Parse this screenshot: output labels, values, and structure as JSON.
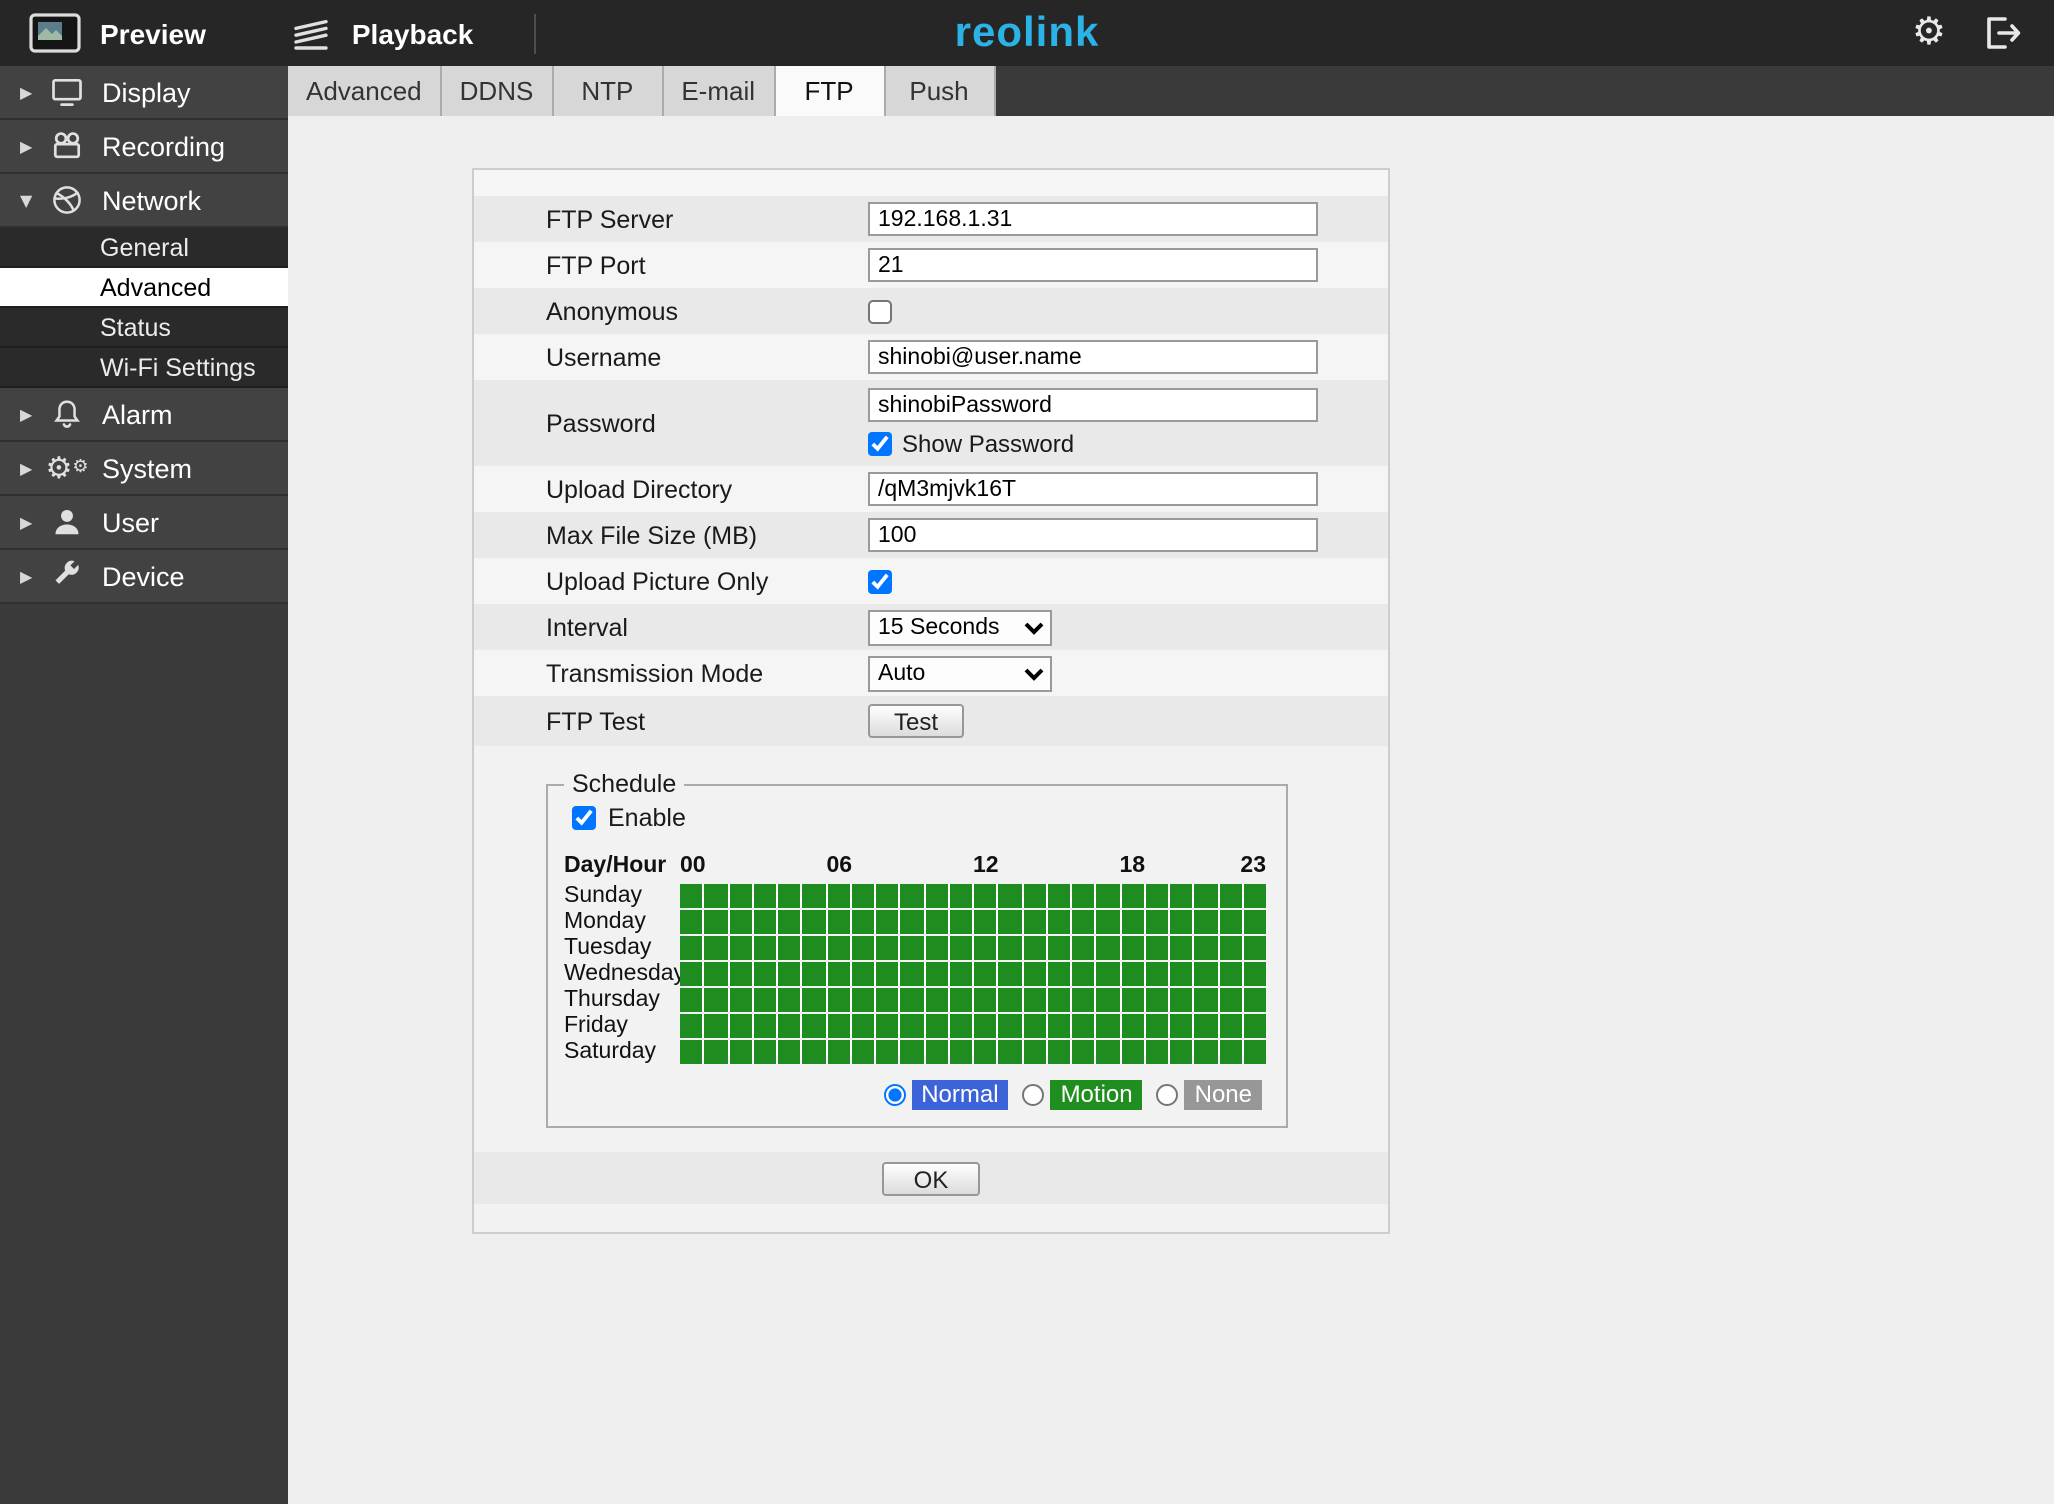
{
  "topbar": {
    "preview_label": "Preview",
    "playback_label": "Playback",
    "logo_text": "reolink",
    "gear_glyph": "⚙"
  },
  "icons": {
    "top_left": "preview-monitor-icon",
    "playback": "film-strip-icon",
    "settings": "gear-icon",
    "logout": "logout-arrow-icon",
    "display": "monitor-icon",
    "recording": "video-camera-icon",
    "network": "globe-icon",
    "alarm": "bell-icon",
    "system": "gears-icon",
    "user": "person-icon",
    "device": "wrench-icon"
  },
  "sidebar": {
    "items": [
      {
        "label": "Display"
      },
      {
        "label": "Recording"
      },
      {
        "label": "Network"
      },
      {
        "label": "Alarm"
      },
      {
        "label": "System"
      },
      {
        "label": "User"
      },
      {
        "label": "Device"
      }
    ],
    "network_children": [
      {
        "label": "General"
      },
      {
        "label": "Advanced"
      },
      {
        "label": "Status"
      },
      {
        "label": "Wi-Fi Settings"
      }
    ],
    "expanded_item": "Network",
    "active_child": "Advanced"
  },
  "tabs": {
    "items": [
      {
        "label": "Advanced"
      },
      {
        "label": "DDNS"
      },
      {
        "label": "NTP"
      },
      {
        "label": "E-mail"
      },
      {
        "label": "FTP"
      },
      {
        "label": "Push"
      }
    ],
    "active": "FTP"
  },
  "form": {
    "ftp_server": {
      "label": "FTP Server",
      "value": "192.168.1.31"
    },
    "ftp_port": {
      "label": "FTP Port",
      "value": "21"
    },
    "anonymous": {
      "label": "Anonymous",
      "checked": false
    },
    "username": {
      "label": "Username",
      "value": "shinobi@user.name"
    },
    "password": {
      "label": "Password",
      "value": "shinobiPassword",
      "show_password_label": "Show Password",
      "show_password_checked": true
    },
    "upload_directory": {
      "label": "Upload Directory",
      "value": "/qM3mjvk16T"
    },
    "max_file_size": {
      "label": "Max File Size (MB)",
      "value": "100"
    },
    "upload_picture_only": {
      "label": "Upload Picture Only",
      "checked": true
    },
    "interval": {
      "label": "Interval",
      "value": "15 Seconds"
    },
    "transmission_mode": {
      "label": "Transmission Mode",
      "value": "Auto"
    },
    "ftp_test": {
      "label": "FTP Test",
      "button_label": "Test"
    },
    "ok_label": "OK"
  },
  "schedule": {
    "legend": "Schedule",
    "enable_label": "Enable",
    "enable_checked": true,
    "day_hour_label": "Day/Hour",
    "hour_labels": [
      "00",
      "06",
      "12",
      "18",
      "23"
    ],
    "hour_label_positions": [
      0,
      6,
      12,
      18,
      23
    ],
    "columns": 24,
    "days": [
      "Sunday",
      "Monday",
      "Tuesday",
      "Wednesday",
      "Thursday",
      "Friday",
      "Saturday"
    ],
    "all_cells_on": true,
    "on_color": "#1e8c1e",
    "modes": [
      {
        "label": "Normal",
        "color": "#3c64d8",
        "selected": true
      },
      {
        "label": "Motion",
        "color": "#1f8e1f",
        "selected": false
      },
      {
        "label": "None",
        "color": "#979797",
        "selected": false
      }
    ]
  },
  "colors": {
    "logo": "#2bb3e8",
    "topbar_bg": "#262626",
    "sidebar_bg": "#3a3a3a",
    "schedule_on": "#1e8c1e"
  }
}
